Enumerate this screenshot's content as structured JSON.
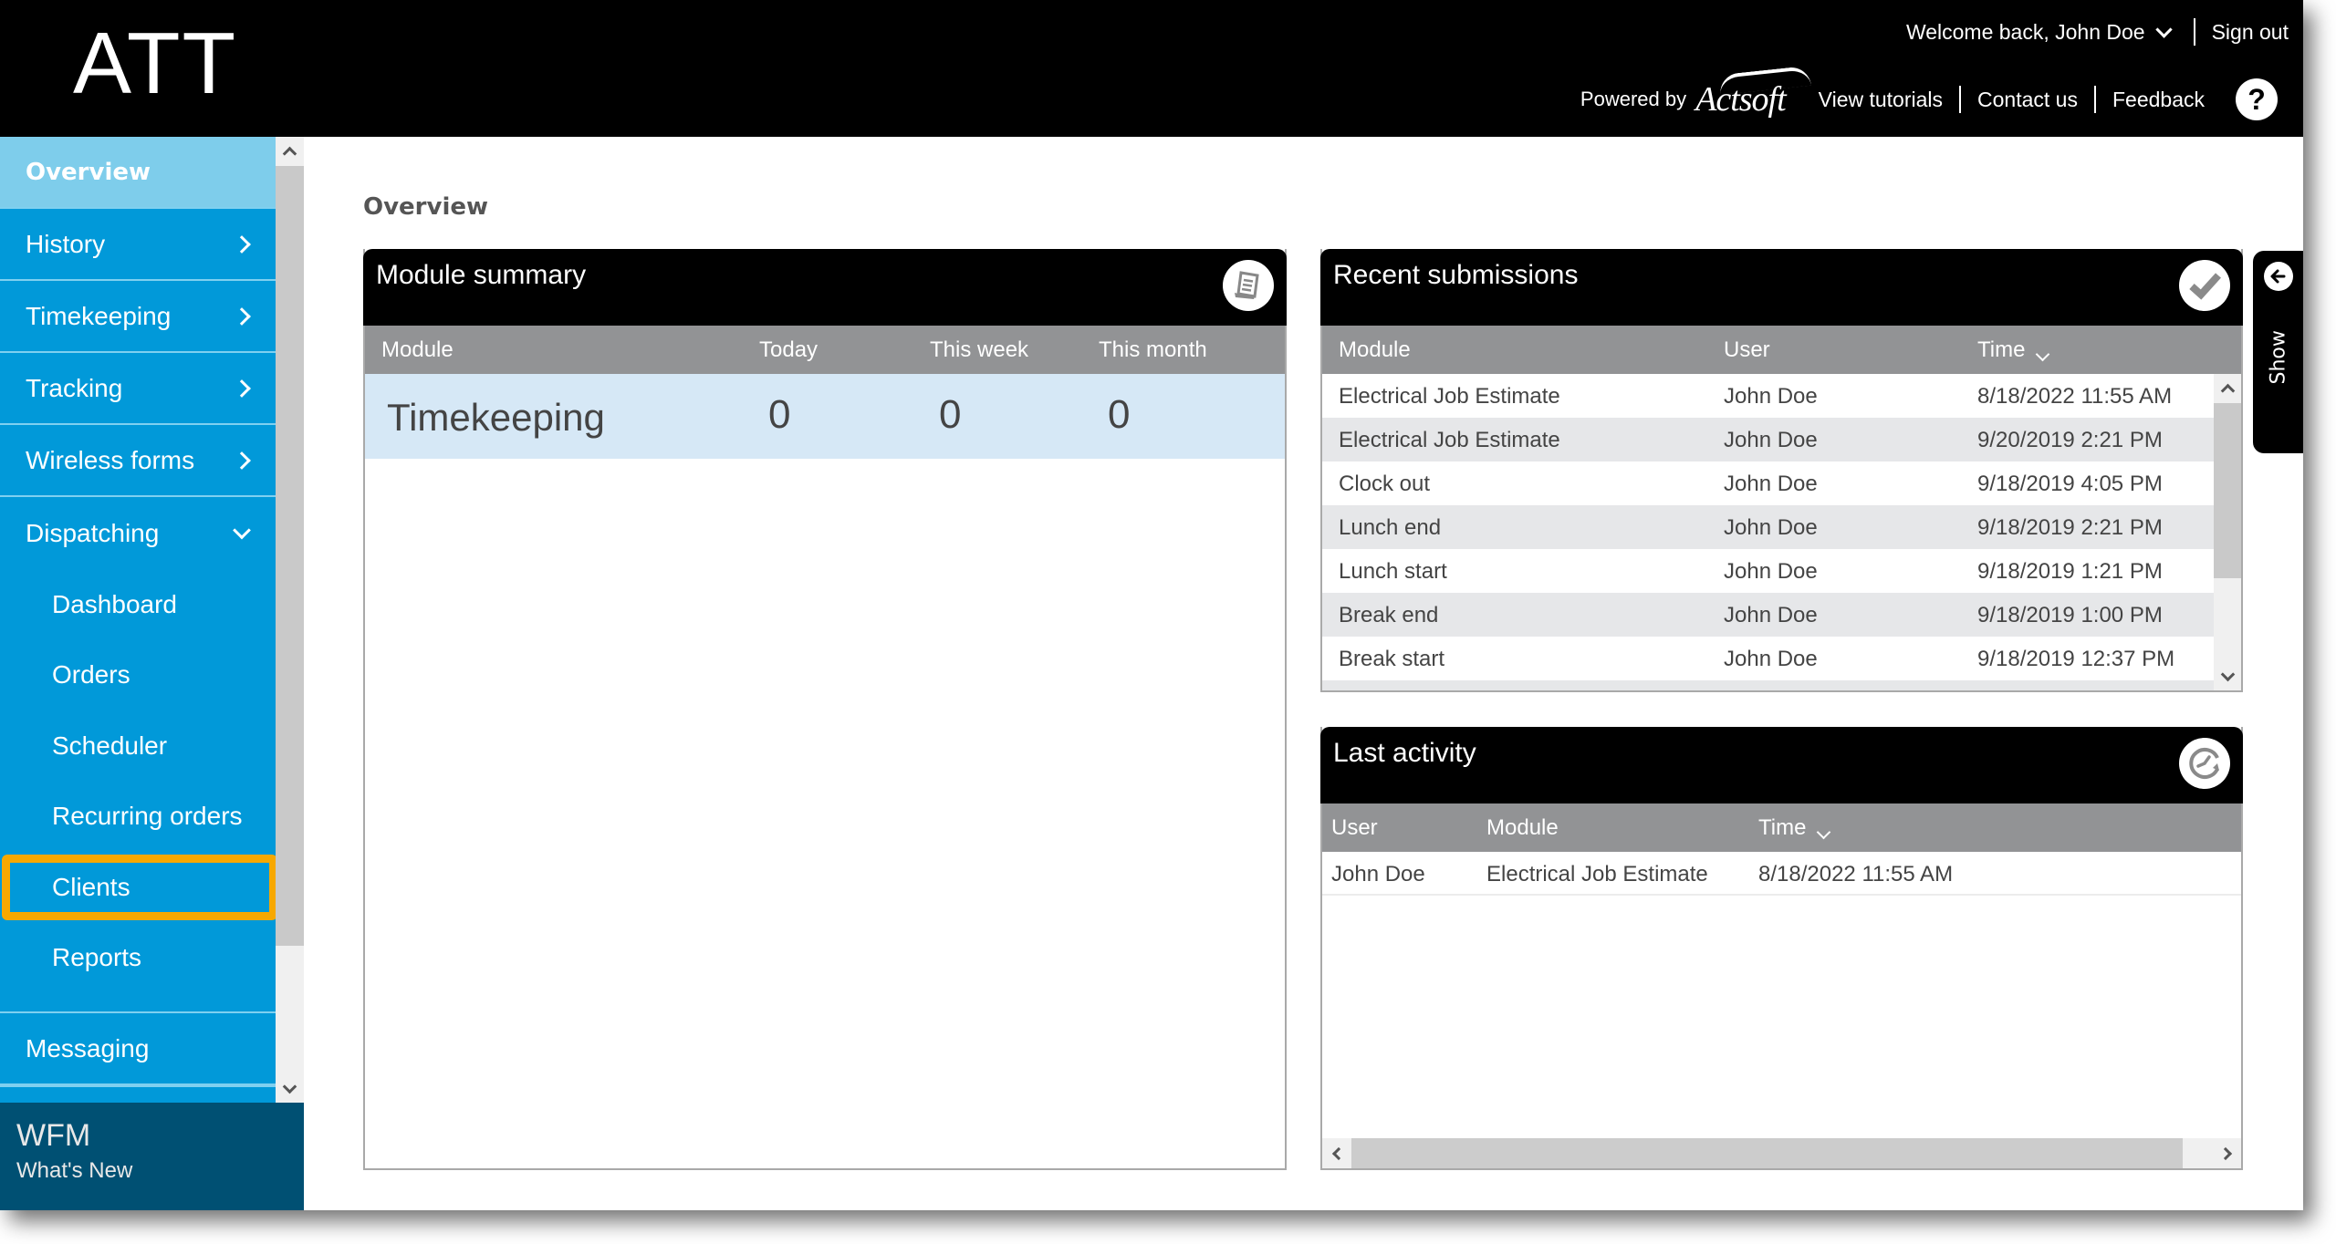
{
  "header": {
    "logo": "ATT",
    "welcome": "Welcome back, John Doe",
    "sign_out": "Sign out",
    "powered_by": "Powered by",
    "brand": "Actsoft",
    "links": [
      "View tutorials",
      "Contact us",
      "Feedback"
    ],
    "help_glyph": "?"
  },
  "sidebar": {
    "items": [
      {
        "label": "Overview",
        "icon": "none",
        "active": true
      },
      {
        "label": "History",
        "icon": "chevron-right"
      },
      {
        "label": "Timekeeping",
        "icon": "chevron-right"
      },
      {
        "label": "Tracking",
        "icon": "chevron-right"
      },
      {
        "label": "Wireless forms",
        "icon": "chevron-right"
      },
      {
        "label": "Dispatching",
        "icon": "chevron-down",
        "expanded": true
      }
    ],
    "dispatching_sub": [
      "Dashboard",
      "Orders",
      "Scheduler",
      "Recurring orders",
      "Clients",
      "Reports"
    ],
    "highlighted_sub": "Clients",
    "highlight_color": "#f7a800",
    "after": [
      {
        "label": "Messaging"
      }
    ],
    "footer": {
      "title": "WFM",
      "subtitle": "What's New"
    }
  },
  "main": {
    "title": "Overview",
    "module_summary": {
      "title": "Module summary",
      "icon": "document-list-icon",
      "columns": [
        "Module",
        "Today",
        "This week",
        "This month"
      ],
      "rows": [
        {
          "module": "Timekeeping",
          "today": "0",
          "week": "0",
          "month": "0"
        }
      ]
    },
    "recent_submissions": {
      "title": "Recent submissions",
      "icon": "checkmark-icon",
      "columns": [
        "Module",
        "User",
        "Time"
      ],
      "sorted_by": "Time",
      "rows": [
        {
          "module": "Electrical Job Estimate",
          "user": "John Doe",
          "time": "8/18/2022 11:55 AM"
        },
        {
          "module": "Electrical Job Estimate",
          "user": "John Doe",
          "time": "9/20/2019 2:21 PM"
        },
        {
          "module": "Clock out",
          "user": "John Doe",
          "time": "9/18/2019 4:05 PM"
        },
        {
          "module": "Lunch end",
          "user": "John Doe",
          "time": "9/18/2019 2:21 PM"
        },
        {
          "module": "Lunch start",
          "user": "John Doe",
          "time": "9/18/2019 1:21 PM"
        },
        {
          "module": "Break end",
          "user": "John Doe",
          "time": "9/18/2019 1:00 PM"
        },
        {
          "module": "Break start",
          "user": "John Doe",
          "time": "9/18/2019 12:37 PM"
        }
      ]
    },
    "show_tab": {
      "label": "Show",
      "icon": "arrow-left-icon"
    },
    "last_activity": {
      "title": "Last activity",
      "icon": "clock-history-icon",
      "columns": [
        "User",
        "Module",
        "Time"
      ],
      "sorted_by": "Time",
      "rows": [
        {
          "user": "John Doe",
          "module": "Electrical Job Estimate",
          "time": "8/18/2022 11:55 AM"
        }
      ]
    }
  },
  "colors": {
    "header_bg": "#000000",
    "sidebar_bg": "#0199d9",
    "sidebar_active": "#7ecdeb",
    "footer_bg": "#005073",
    "column_header_bg": "#929395",
    "summary_row_bg": "#d6e8f6",
    "alt_row_bg": "#e6e7e9"
  }
}
